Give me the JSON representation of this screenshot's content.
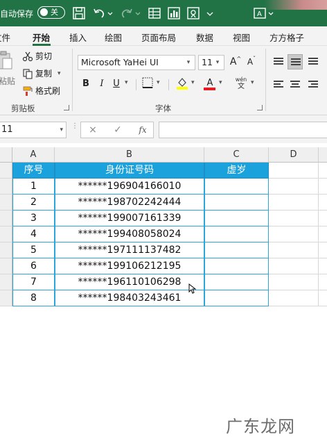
{
  "titlebar": {
    "autosave_label": "自动保存",
    "toggle_label": "关",
    "icons": [
      "save-icon",
      "undo-icon",
      "redo-icon",
      "table-icon",
      "chart-icon",
      "fill-icon",
      "text-icon"
    ]
  },
  "tabs": [
    "文件",
    "开始",
    "插入",
    "绘图",
    "页面布局",
    "数据",
    "视图",
    "方方格子"
  ],
  "active_tab": "开始",
  "clipboard": {
    "paste": "粘贴",
    "cut": "剪切",
    "copy": "复制",
    "format_painter": "格式刷",
    "group_label": "剪贴板"
  },
  "font": {
    "family": "Microsoft YaHei UI",
    "size": "11",
    "bold": "B",
    "italic": "I",
    "underline": "U",
    "font_color_label": "A",
    "pinyin_top": "wén",
    "pinyin_bottom": "文",
    "grow": "A",
    "shrink": "A",
    "group_label": "字体",
    "fill_color": "#ffff00",
    "font_color": "#e51c23"
  },
  "formula_bar": {
    "name_box": "11",
    "cancel": "×",
    "enter": "✓",
    "fx": "fx",
    "value": ""
  },
  "grid": {
    "columns": [
      "A",
      "B",
      "C",
      "D"
    ],
    "header_row": [
      "序号",
      "身份证号码",
      "虚岁"
    ],
    "rows": [
      [
        "1",
        "******196904166010",
        ""
      ],
      [
        "2",
        "******198702242444",
        ""
      ],
      [
        "3",
        "******199007161339",
        ""
      ],
      [
        "4",
        "******199408058024",
        ""
      ],
      [
        "5",
        "******197111137482",
        ""
      ],
      [
        "6",
        "******199106212195",
        ""
      ],
      [
        "7",
        "******196110106298",
        ""
      ],
      [
        "8",
        "******198403243461",
        ""
      ]
    ],
    "header_color": "#1ba2dc",
    "border_color": "#2aa6dc"
  },
  "watermark": "广东龙网"
}
